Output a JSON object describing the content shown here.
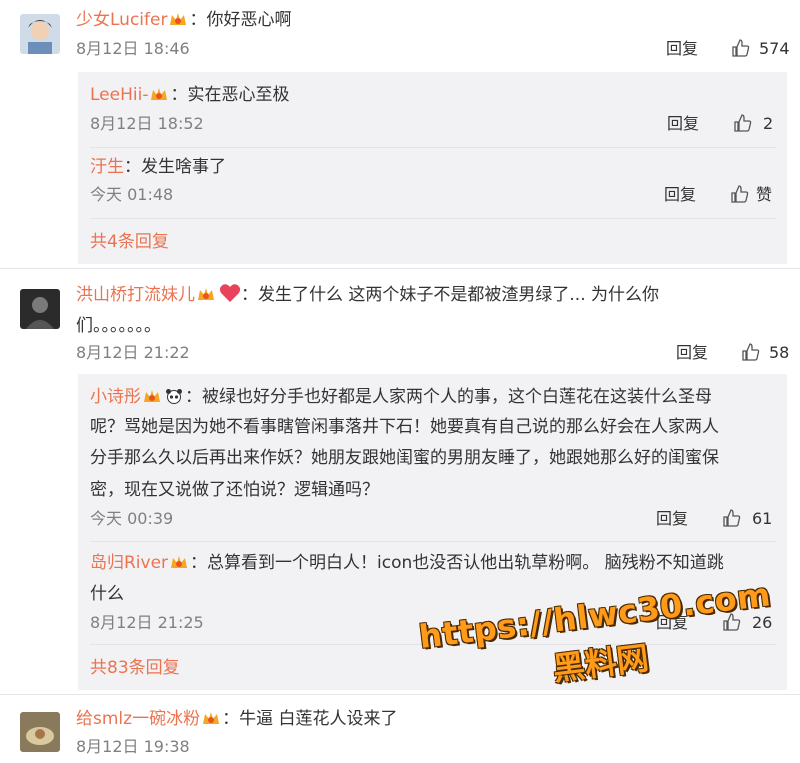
{
  "comments": [
    {
      "user": "少女Lucifer",
      "text": "：你好恶心啊",
      "time": "8月12日 18:46",
      "reply": "回复",
      "likes": "574",
      "replies": [
        {
          "user": "LeeHii-",
          "text": "：实在恶心至极",
          "time": "8月12日 18:52",
          "reply": "回复",
          "likes": "2"
        },
        {
          "user": "汙生",
          "text": "：发生啥事了",
          "time": "今天 01:48",
          "reply": "回复",
          "likes": "赞"
        }
      ],
      "more": "共4条回复"
    },
    {
      "user": "洪山桥打流妹儿",
      "text_line1": "：发生了什么 这两个妹子不是都被渣男绿了... 为什么你",
      "text_line2": "们。。。。。。。",
      "time": "8月12日 21:22",
      "reply": "回复",
      "likes": "58",
      "replies": [
        {
          "user": "小诗彤",
          "text_line1": "：被绿也好分手也好都是人家两个人的事，这个白莲花在这装什么圣母",
          "text_line2": "呢？骂她是因为她不看事瞎管闲事落井下石！她要真有自己说的那么好会在人家两人",
          "text_line3": "分手那么久以后再出来作妖？她朋友跟她闺蜜的男朋友睡了，她跟她那么好的闺蜜保",
          "text_line4": "密，现在又说做了还怕说？逻辑通吗？",
          "time": "今天 00:39",
          "reply": "回复",
          "likes": "61"
        },
        {
          "user": "岛归River",
          "text_line1": "：总算看到一个明白人！icon也没否认他出轨草粉啊。 脑残粉不知道跳",
          "text_line2": "什么",
          "time": "8月12日 21:25",
          "reply": "回复",
          "likes": "26"
        }
      ],
      "more": "共83条回复"
    },
    {
      "user": "给smlz一碗冰粉",
      "text": "：牛逼 白莲花人设来了",
      "time": "8月12日 19:38"
    }
  ],
  "watermark": {
    "url": "https://hlwc30.com",
    "label": "黑料网"
  },
  "colors": {
    "username": "#eb7350",
    "time": "#808080",
    "subbox": "#f2f2f5",
    "watermark": "#ff9a1a"
  },
  "icons": [
    "thumbs-up-icon",
    "vip-badge-icon",
    "heart-icon",
    "panda-icon"
  ]
}
